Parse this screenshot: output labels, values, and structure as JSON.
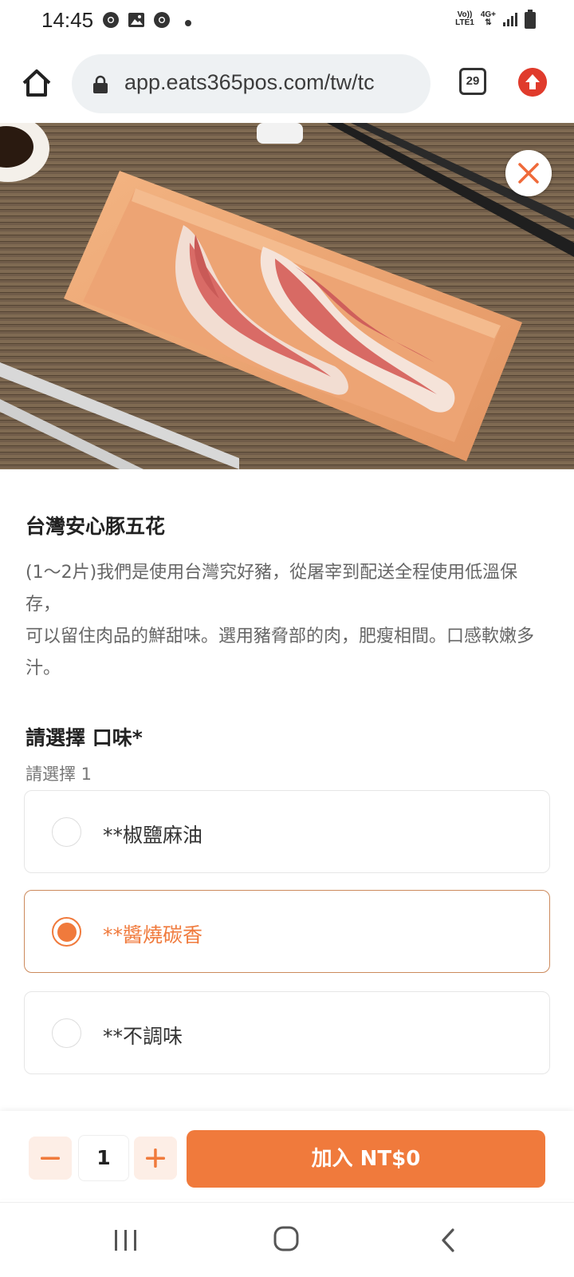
{
  "status_bar": {
    "time": "14:45",
    "net_top": "Vo))",
    "net_bottom": "LTE1",
    "net_type": "4G+"
  },
  "browser": {
    "url": "app.eats365pos.com/tw/tc",
    "tab_count": "29"
  },
  "product": {
    "title": "台灣安心豚五花",
    "description": "(1～2片)我們是使用台灣究好豬，從屠宰到配送全程使用低溫保存，\n可以留住肉品的鮮甜味。選用豬脅部的肉，肥瘦相間。口感軟嫩多汁。"
  },
  "options": {
    "header": "請選擇 口味*",
    "subheader": "請選擇 1",
    "items": [
      {
        "label": "**椒鹽麻油",
        "selected": false
      },
      {
        "label": "**醬燒碳香",
        "selected": true
      },
      {
        "label": "**不調味",
        "selected": false
      }
    ]
  },
  "cart": {
    "quantity": "1",
    "add_label": "加入 NT$0"
  },
  "colors": {
    "accent": "#f07a3c",
    "accent_light": "#fdeee6",
    "close_icon": "#ef6a3a",
    "update_badge": "#e03b2c"
  }
}
